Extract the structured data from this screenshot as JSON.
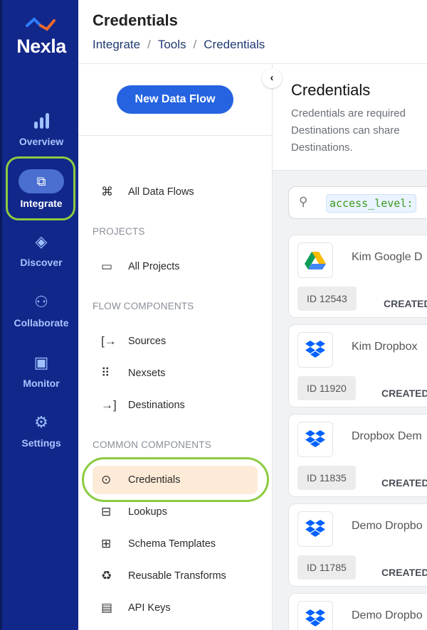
{
  "brand": {
    "name": "Nexla",
    "accent": "#2563e0",
    "highlight_ring": "#8ccb3f"
  },
  "nav": [
    {
      "label": "Overview",
      "icon": "bar-chart-icon"
    },
    {
      "label": "Integrate",
      "icon": "puzzle-icon",
      "active": true
    },
    {
      "label": "Discover",
      "icon": "compass-icon"
    },
    {
      "label": "Collaborate",
      "icon": "people-icon"
    },
    {
      "label": "Monitor",
      "icon": "monitor-icon"
    },
    {
      "label": "Settings",
      "icon": "gear-icon"
    }
  ],
  "header": {
    "title": "Credentials",
    "breadcrumb": [
      "Integrate",
      "Tools",
      "Credentials"
    ]
  },
  "left": {
    "new_button": "New Data Flow",
    "all_flows": "All Data Flows",
    "projects_heading": "PROJECTS",
    "all_projects": "All Projects",
    "flow_heading": "FLOW COMPONENTS",
    "flow_items": [
      "Sources",
      "Nexsets",
      "Destinations"
    ],
    "common_heading": "COMMON COMPONENTS",
    "common_items": [
      "Credentials",
      "Lookups",
      "Schema Templates",
      "Reusable Transforms",
      "API Keys"
    ],
    "selected": "Credentials"
  },
  "main": {
    "title": "Credentials",
    "desc": [
      "Credentials are required",
      "Destinations can share",
      "Destinations."
    ],
    "search_value": "access_level:",
    "created_label": "CREATED ON",
    "cards": [
      {
        "name": "Kim Google D",
        "id": "ID 12543",
        "logo": "google-drive-icon"
      },
      {
        "name": "Kim Dropbox",
        "id": "ID 11920",
        "logo": "dropbox-icon"
      },
      {
        "name": "Dropbox Dem",
        "id": "ID 11835",
        "logo": "dropbox-icon"
      },
      {
        "name": "Demo Dropbo",
        "id": "ID 11785",
        "logo": "dropbox-icon"
      },
      {
        "name": "Demo Dropbo",
        "logo": "dropbox-icon"
      }
    ]
  }
}
